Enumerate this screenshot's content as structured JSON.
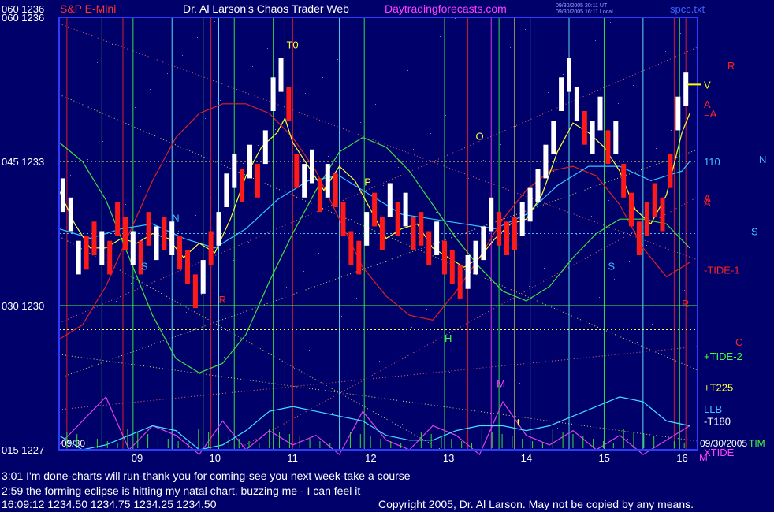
{
  "header": {
    "left": "060 1236",
    "product": "S&P E-Mini",
    "title": "Dr. Al Larson's Chaos Trader Web",
    "site": "Daytradingforecasts.com",
    "stamp1": "09/30/2005 20:11 UT",
    "stamp2": "09/30/2005 16:11 Local",
    "file": "spcc.txt"
  },
  "colors": {
    "bg": "#00006a",
    "frame": "#2c3cff",
    "up": "#ffffff",
    "down": "#ff1a1a"
  },
  "chart_data": {
    "type": "line",
    "title": "S&P E-Mini",
    "y_axis_labels": [
      {
        "code": "060",
        "value": 1236
      },
      {
        "code": "045",
        "value": 1233
      },
      {
        "code": "030",
        "value": 1230
      },
      {
        "code": "015",
        "value": 1227
      }
    ],
    "ylim": [
      1227,
      1236
    ],
    "x_ticks": [
      "09",
      "10",
      "11",
      "12",
      "13",
      "14",
      "15",
      "16"
    ],
    "xlim": [
      8.0,
      16.2
    ],
    "start_label": "09/30",
    "end_label": "09/30/2005",
    "end_label_suffix": "TIM",
    "right_labels": [
      {
        "text": "V",
        "color": "#ffff00",
        "y": 1234.6
      },
      {
        "text": "R",
        "color": "#ff2020",
        "y": 1235.0,
        "dx": 30
      },
      {
        "text": "A",
        "color": "#ff2020",
        "y": 1234.2
      },
      {
        "text": "=A",
        "color": "#ff2020",
        "y": 1234.0
      },
      {
        "text": "110",
        "color": "#40c0ff",
        "y": 1233.0
      },
      {
        "text": "N",
        "color": "#40c0ff",
        "y": 1233.05,
        "dx": 70
      },
      {
        "text": "A",
        "color": "#ff2020",
        "y": 1232.25
      },
      {
        "text": "A",
        "color": "#ff2020",
        "y": 1232.15
      },
      {
        "text": "S",
        "color": "#40c0ff",
        "y": 1231.55,
        "dx": 60
      },
      {
        "text": "-TIDE-1",
        "color": "#ff2020",
        "y": 1230.75
      },
      {
        "text": "R",
        "color": "#ff2020",
        "y": 1230.05,
        "dx": -28
      },
      {
        "text": "C",
        "color": "#ff2020",
        "y": 1229.25,
        "dx": 40
      },
      {
        "text": "+TIDE-2",
        "color": "#40ff40",
        "y": 1228.95
      },
      {
        "text": "+T225",
        "color": "#ffff40",
        "y": 1228.3
      },
      {
        "text": "LLB",
        "color": "#40c0ff",
        "y": 1227.85
      },
      {
        "text": "-T180",
        "color": "#ffffff",
        "y": 1227.6
      },
      {
        "text": "XTIDE",
        "color": "#ff40ff",
        "y": 1226.95
      },
      {
        "text": "M",
        "color": "#ff40ff",
        "y": 1226.85,
        "dx": -6
      }
    ],
    "annotations": [
      {
        "text": "T0",
        "x": 10.92,
        "y": 1235.35,
        "color": "#ffff40"
      },
      {
        "text": "O",
        "x": 13.35,
        "y": 1233.45,
        "color": "#ffff40"
      },
      {
        "text": "P",
        "x": 11.92,
        "y": 1232.5,
        "color": "#ffff40"
      },
      {
        "text": "N",
        "x": 9.45,
        "y": 1231.75,
        "color": "#40c0ff"
      },
      {
        "text": "S",
        "x": 9.05,
        "y": 1230.75,
        "color": "#40c0ff"
      },
      {
        "text": "S",
        "x": 15.05,
        "y": 1230.75,
        "color": "#40c0ff"
      },
      {
        "text": "R",
        "x": 10.05,
        "y": 1230.05,
        "color": "#ff2020"
      },
      {
        "text": "H",
        "x": 12.95,
        "y": 1229.25,
        "color": "#40ff40"
      },
      {
        "text": "M",
        "x": 13.62,
        "y": 1228.3,
        "color": "#ff40ff"
      },
      {
        "text": "t",
        "x": 13.88,
        "y": 1227.5,
        "color": "#ffff40"
      }
    ],
    "vertical_lines": [
      {
        "x": 8.1,
        "color": "#ff2020"
      },
      {
        "x": 8.55,
        "color": "#40ff40"
      },
      {
        "x": 8.82,
        "color": "#ff2020"
      },
      {
        "x": 8.95,
        "color": "#40ff40"
      },
      {
        "x": 9.45,
        "color": "#70ffff"
      },
      {
        "x": 9.85,
        "color": "#40ff40"
      },
      {
        "x": 9.95,
        "color": "#ff2020"
      },
      {
        "x": 10.05,
        "color": "#70ffff"
      },
      {
        "x": 10.25,
        "color": "#40ff40"
      },
      {
        "x": 10.75,
        "color": "#40ff40"
      },
      {
        "x": 10.9,
        "color": "#ffff40"
      },
      {
        "x": 11.0,
        "color": "#ff2020"
      },
      {
        "x": 11.6,
        "color": "#70ffff"
      },
      {
        "x": 11.92,
        "color": "#40ff40"
      },
      {
        "x": 12.95,
        "color": "#40ff40"
      },
      {
        "x": 13.25,
        "color": "#ff2020"
      },
      {
        "x": 13.55,
        "color": "#ff40ff"
      },
      {
        "x": 13.65,
        "color": "#40ff40"
      },
      {
        "x": 13.85,
        "color": "#ffff40"
      },
      {
        "x": 14.05,
        "color": "#70ffff"
      },
      {
        "x": 14.1,
        "color": "#2c3cff"
      },
      {
        "x": 14.55,
        "color": "#70ffff"
      },
      {
        "x": 15.0,
        "color": "#40ff40"
      },
      {
        "x": 15.5,
        "color": "#70ffff"
      },
      {
        "x": 15.9,
        "color": "#ff2020"
      },
      {
        "x": 15.97,
        "color": "#40ff40"
      },
      {
        "x": 16.05,
        "color": "#ff2020"
      }
    ],
    "horizontal_lines": [
      {
        "y": 1233.0,
        "color": "#ffff40",
        "style": "dotted"
      },
      {
        "y": 1231.5,
        "color": "#40c0ff",
        "style": "dotted"
      },
      {
        "y": 1230.0,
        "color": "#40ff40",
        "style": "solid"
      },
      {
        "y": 1229.5,
        "color": "#ffff40",
        "style": "dotted"
      }
    ],
    "series": [
      {
        "name": "TIDE-1",
        "color": "#e02020",
        "x": [
          8.0,
          8.3,
          8.6,
          8.9,
          9.2,
          9.5,
          9.8,
          10.1,
          10.4,
          10.7,
          11.0,
          11.3,
          11.6,
          11.9,
          12.2,
          12.5,
          12.8,
          13.1,
          13.4,
          13.7,
          14.0,
          14.3,
          14.6,
          14.9,
          15.2,
          15.5,
          15.8,
          16.1
        ],
        "y": [
          1229.3,
          1229.6,
          1230.4,
          1231.5,
          1232.6,
          1233.5,
          1234.0,
          1234.2,
          1234.2,
          1234.0,
          1233.5,
          1232.8,
          1231.8,
          1230.8,
          1230.2,
          1229.8,
          1229.7,
          1230.3,
          1231.0,
          1231.8,
          1232.4,
          1232.8,
          1232.9,
          1232.7,
          1232.1,
          1231.2,
          1230.6,
          1230.9
        ]
      },
      {
        "name": "TIDE-2",
        "color": "#40e040",
        "x": [
          8.0,
          8.3,
          8.6,
          8.9,
          9.2,
          9.5,
          9.8,
          10.1,
          10.4,
          10.7,
          11.0,
          11.3,
          11.6,
          11.9,
          12.2,
          12.5,
          12.8,
          13.1,
          13.4,
          13.7,
          14.0,
          14.3,
          14.6,
          14.9,
          15.2,
          15.5,
          15.8,
          16.1
        ],
        "y": [
          1233.4,
          1233.0,
          1232.2,
          1231.0,
          1229.8,
          1228.9,
          1228.6,
          1228.8,
          1229.4,
          1230.5,
          1231.5,
          1232.4,
          1233.2,
          1233.5,
          1233.3,
          1232.8,
          1232.1,
          1231.4,
          1230.8,
          1230.3,
          1230.1,
          1230.4,
          1231.0,
          1231.5,
          1231.8,
          1231.8,
          1231.7,
          1231.2
        ]
      },
      {
        "name": "LLB",
        "color": "#30c8ff",
        "x": [
          8.0,
          8.4,
          8.8,
          9.2,
          9.6,
          10.0,
          10.4,
          10.8,
          11.2,
          11.6,
          12.0,
          12.4,
          12.8,
          13.2,
          13.6,
          14.0,
          14.4,
          14.8,
          15.2,
          15.6,
          16.0,
          16.1
        ],
        "y": [
          1231.6,
          1231.4,
          1231.6,
          1231.7,
          1231.4,
          1231.2,
          1231.6,
          1232.2,
          1232.6,
          1232.7,
          1232.3,
          1231.9,
          1231.8,
          1231.7,
          1231.6,
          1231.9,
          1232.5,
          1232.9,
          1232.9,
          1232.6,
          1232.8,
          1233.0
        ]
      },
      {
        "name": "Price MA",
        "color": "#ffff30",
        "x": [
          8.0,
          8.2,
          8.4,
          8.6,
          8.8,
          9.0,
          9.2,
          9.4,
          9.6,
          9.8,
          10.0,
          10.2,
          10.4,
          10.6,
          10.8,
          10.9,
          11.0,
          11.2,
          11.4,
          11.6,
          11.8,
          12.0,
          12.2,
          12.4,
          12.6,
          12.8,
          13.0,
          13.2,
          13.4,
          13.6,
          13.8,
          14.0,
          14.2,
          14.4,
          14.6,
          14.8,
          15.0,
          15.2,
          15.4,
          15.6,
          15.8,
          16.0,
          16.1
        ],
        "y": [
          1232.4,
          1231.7,
          1231.2,
          1231.2,
          1231.4,
          1231.3,
          1231.5,
          1231.4,
          1231.0,
          1231.3,
          1231.1,
          1231.8,
          1232.7,
          1233.3,
          1233.6,
          1233.9,
          1233.4,
          1232.9,
          1232.4,
          1232.9,
          1232.6,
          1232.0,
          1231.4,
          1231.6,
          1231.7,
          1231.2,
          1231.0,
          1230.8,
          1231.0,
          1231.4,
          1231.7,
          1231.8,
          1232.3,
          1233.2,
          1233.8,
          1233.6,
          1233.3,
          1232.8,
          1232.0,
          1231.7,
          1232.3,
          1233.6,
          1234.0
        ]
      },
      {
        "name": "XTIDE",
        "color": "#e040e0",
        "x": [
          8.0,
          8.3,
          8.6,
          8.9,
          9.2,
          9.5,
          9.8,
          10.1,
          10.4,
          10.7,
          11.0,
          11.3,
          11.6,
          11.9,
          12.2,
          12.5,
          12.8,
          13.1,
          13.4,
          13.7,
          14.0,
          14.3,
          14.6,
          14.9,
          15.2,
          15.5,
          15.8,
          16.1
        ],
        "y": [
          1227.1,
          1227.6,
          1228.1,
          1227.0,
          1227.5,
          1227.3,
          1226.9,
          1227.6,
          1227.0,
          1227.4,
          1227.1,
          1227.3,
          1226.9,
          1227.8,
          1227.2,
          1227.0,
          1227.5,
          1227.3,
          1226.9,
          1228.0,
          1227.3,
          1227.1,
          1227.4,
          1227.0,
          1227.3,
          1226.9,
          1227.2,
          1227.5
        ]
      },
      {
        "name": "T180",
        "color": "#40e0ff",
        "x": [
          8.0,
          8.3,
          8.6,
          8.9,
          9.2,
          9.5,
          9.8,
          10.1,
          10.4,
          10.7,
          11.0,
          11.3,
          11.6,
          11.9,
          12.2,
          12.5,
          12.8,
          13.1,
          13.4,
          13.7,
          14.0,
          14.3,
          14.6,
          14.9,
          15.2,
          15.5,
          15.8,
          16.1
        ],
        "y": [
          1227.3,
          1227.0,
          1227.1,
          1227.3,
          1227.5,
          1227.4,
          1227.0,
          1227.1,
          1227.4,
          1227.8,
          1227.9,
          1227.8,
          1227.7,
          1227.6,
          1227.3,
          1227.2,
          1227.2,
          1227.4,
          1227.5,
          1227.5,
          1227.4,
          1227.5,
          1227.7,
          1227.9,
          1228.1,
          1228.0,
          1227.6,
          1227.5
        ]
      }
    ],
    "price_bars": [
      {
        "x": 8.05,
        "y": 1232.3,
        "up": true
      },
      {
        "x": 8.15,
        "y": 1231.9,
        "up": true
      },
      {
        "x": 8.25,
        "y": 1231.0,
        "up": true
      },
      {
        "x": 8.35,
        "y": 1231.1,
        "up": false
      },
      {
        "x": 8.45,
        "y": 1231.4,
        "up": false
      },
      {
        "x": 8.55,
        "y": 1231.2,
        "up": true
      },
      {
        "x": 8.65,
        "y": 1231.0,
        "up": false
      },
      {
        "x": 8.75,
        "y": 1231.8,
        "up": false
      },
      {
        "x": 8.85,
        "y": 1231.5,
        "up": false
      },
      {
        "x": 8.95,
        "y": 1231.2,
        "up": true
      },
      {
        "x": 9.05,
        "y": 1231.0,
        "up": false
      },
      {
        "x": 9.15,
        "y": 1231.6,
        "up": false
      },
      {
        "x": 9.25,
        "y": 1231.3,
        "up": true
      },
      {
        "x": 9.35,
        "y": 1231.5,
        "up": false
      },
      {
        "x": 9.45,
        "y": 1231.4,
        "up": true
      },
      {
        "x": 9.55,
        "y": 1231.1,
        "up": false
      },
      {
        "x": 9.65,
        "y": 1230.8,
        "up": false
      },
      {
        "x": 9.75,
        "y": 1230.3,
        "up": false
      },
      {
        "x": 9.85,
        "y": 1230.6,
        "up": true
      },
      {
        "x": 9.95,
        "y": 1231.2,
        "up": false
      },
      {
        "x": 10.05,
        "y": 1231.6,
        "up": true
      },
      {
        "x": 10.15,
        "y": 1232.4,
        "up": true
      },
      {
        "x": 10.25,
        "y": 1232.8,
        "up": true
      },
      {
        "x": 10.35,
        "y": 1232.5,
        "up": false
      },
      {
        "x": 10.45,
        "y": 1233.0,
        "up": true
      },
      {
        "x": 10.55,
        "y": 1232.6,
        "up": false
      },
      {
        "x": 10.65,
        "y": 1233.3,
        "up": true
      },
      {
        "x": 10.75,
        "y": 1234.4,
        "up": true
      },
      {
        "x": 10.85,
        "y": 1234.8,
        "up": true
      },
      {
        "x": 10.95,
        "y": 1234.2,
        "up": false
      },
      {
        "x": 11.05,
        "y": 1232.8,
        "up": false
      },
      {
        "x": 11.15,
        "y": 1232.6,
        "up": true
      },
      {
        "x": 11.25,
        "y": 1232.9,
        "up": true
      },
      {
        "x": 11.35,
        "y": 1232.3,
        "up": false
      },
      {
        "x": 11.45,
        "y": 1232.6,
        "up": true
      },
      {
        "x": 11.55,
        "y": 1232.4,
        "up": false
      },
      {
        "x": 11.65,
        "y": 1231.8,
        "up": false
      },
      {
        "x": 11.75,
        "y": 1231.2,
        "up": false
      },
      {
        "x": 11.85,
        "y": 1231.0,
        "up": false
      },
      {
        "x": 11.95,
        "y": 1231.6,
        "up": true
      },
      {
        "x": 12.05,
        "y": 1232.0,
        "up": false
      },
      {
        "x": 12.15,
        "y": 1231.5,
        "up": false
      },
      {
        "x": 12.25,
        "y": 1232.2,
        "up": true
      },
      {
        "x": 12.35,
        "y": 1231.8,
        "up": false
      },
      {
        "x": 12.45,
        "y": 1232.0,
        "up": true
      },
      {
        "x": 12.55,
        "y": 1231.5,
        "up": false
      },
      {
        "x": 12.65,
        "y": 1231.6,
        "up": false
      },
      {
        "x": 12.75,
        "y": 1231.2,
        "up": false
      },
      {
        "x": 12.85,
        "y": 1231.4,
        "up": true
      },
      {
        "x": 12.95,
        "y": 1231.0,
        "up": false
      },
      {
        "x": 13.05,
        "y": 1230.8,
        "up": false
      },
      {
        "x": 13.15,
        "y": 1230.5,
        "up": false
      },
      {
        "x": 13.25,
        "y": 1230.7,
        "up": true
      },
      {
        "x": 13.35,
        "y": 1231.0,
        "up": true
      },
      {
        "x": 13.45,
        "y": 1231.3,
        "up": true
      },
      {
        "x": 13.55,
        "y": 1231.9,
        "up": true
      },
      {
        "x": 13.65,
        "y": 1231.6,
        "up": false
      },
      {
        "x": 13.75,
        "y": 1231.4,
        "up": false
      },
      {
        "x": 13.85,
        "y": 1231.5,
        "up": false
      },
      {
        "x": 13.95,
        "y": 1231.8,
        "up": true
      },
      {
        "x": 14.05,
        "y": 1232.1,
        "up": true
      },
      {
        "x": 14.15,
        "y": 1232.5,
        "up": true
      },
      {
        "x": 14.25,
        "y": 1233.0,
        "up": true
      },
      {
        "x": 14.35,
        "y": 1233.5,
        "up": true
      },
      {
        "x": 14.45,
        "y": 1234.4,
        "up": true
      },
      {
        "x": 14.55,
        "y": 1234.8,
        "up": true
      },
      {
        "x": 14.65,
        "y": 1234.2,
        "up": true
      },
      {
        "x": 14.75,
        "y": 1233.7,
        "up": false
      },
      {
        "x": 14.85,
        "y": 1233.5,
        "up": true
      },
      {
        "x": 14.95,
        "y": 1234.0,
        "up": true
      },
      {
        "x": 15.05,
        "y": 1233.3,
        "up": false
      },
      {
        "x": 15.15,
        "y": 1233.5,
        "up": true
      },
      {
        "x": 15.25,
        "y": 1232.6,
        "up": false
      },
      {
        "x": 15.35,
        "y": 1232.0,
        "up": false
      },
      {
        "x": 15.45,
        "y": 1231.4,
        "up": false
      },
      {
        "x": 15.55,
        "y": 1231.8,
        "up": false
      },
      {
        "x": 15.65,
        "y": 1232.2,
        "up": false
      },
      {
        "x": 15.75,
        "y": 1231.9,
        "up": false
      },
      {
        "x": 15.85,
        "y": 1232.8,
        "up": false
      },
      {
        "x": 15.95,
        "y": 1234.0,
        "up": true
      },
      {
        "x": 16.05,
        "y": 1234.5,
        "up": true
      }
    ]
  },
  "footer": {
    "line1": "3:01 I'm done-charts will run-thank you for coming-see you next week-take a course",
    "line2": "2:59 the forming eclipse is hitting my natal chart, buzzing me - I can feel it",
    "quote": "16:09:12   1234.50  1234.75  1234.25  1234.50",
    "copyright": "Copyright 2005, Dr. Al Larson. May not be copied by any means."
  }
}
